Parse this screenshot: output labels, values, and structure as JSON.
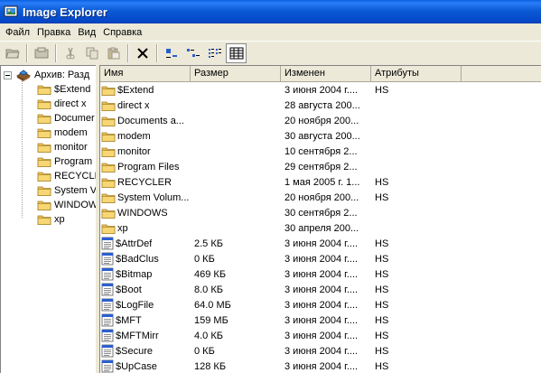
{
  "window": {
    "title": "Image Explorer"
  },
  "menu": [
    "Файл",
    "Правка",
    "Вид",
    "Справка"
  ],
  "tree": {
    "root_label": "Архив: Разд",
    "items": [
      "$Extend",
      "direct x",
      "Documer",
      "modem",
      "monitor",
      "Program",
      "RECYCLER",
      "System V",
      "WINDOW",
      "xp"
    ]
  },
  "list": {
    "columns": [
      "Имя",
      "Размер",
      "Изменен",
      "Атрибуты"
    ],
    "rows": [
      {
        "type": "folder",
        "name": "$Extend",
        "size": "",
        "modified": "3 июня 2004 г....",
        "attr": "HS"
      },
      {
        "type": "folder",
        "name": "direct x",
        "size": "",
        "modified": "28 августа 200...",
        "attr": ""
      },
      {
        "type": "folder",
        "name": "Documents a...",
        "size": "",
        "modified": "20 ноября 200...",
        "attr": ""
      },
      {
        "type": "folder",
        "name": "modem",
        "size": "",
        "modified": "30 августа 200...",
        "attr": ""
      },
      {
        "type": "folder",
        "name": "monitor",
        "size": "",
        "modified": "10 сентября 2...",
        "attr": ""
      },
      {
        "type": "folder",
        "name": "Program Files",
        "size": "",
        "modified": "29 сентября 2...",
        "attr": ""
      },
      {
        "type": "folder",
        "name": "RECYCLER",
        "size": "",
        "modified": "1 мая 2005 г. 1...",
        "attr": "HS"
      },
      {
        "type": "folder",
        "name": "System Volum...",
        "size": "",
        "modified": "20 ноября 200...",
        "attr": "HS"
      },
      {
        "type": "folder",
        "name": "WINDOWS",
        "size": "",
        "modified": "30 сентября 2...",
        "attr": ""
      },
      {
        "type": "folder",
        "name": "xp",
        "size": "",
        "modified": "30 апреля 200...",
        "attr": ""
      },
      {
        "type": "file",
        "name": "$AttrDef",
        "size": "2.5 КБ",
        "modified": "3 июня 2004 г....",
        "attr": "HS"
      },
      {
        "type": "file",
        "name": "$BadClus",
        "size": "0 КБ",
        "modified": "3 июня 2004 г....",
        "attr": "HS"
      },
      {
        "type": "file",
        "name": "$Bitmap",
        "size": "469 КБ",
        "modified": "3 июня 2004 г....",
        "attr": "HS"
      },
      {
        "type": "file",
        "name": "$Boot",
        "size": "8.0 КБ",
        "modified": "3 июня 2004 г....",
        "attr": "HS"
      },
      {
        "type": "file",
        "name": "$LogFile",
        "size": "64.0 МБ",
        "modified": "3 июня 2004 г....",
        "attr": "HS"
      },
      {
        "type": "file",
        "name": "$MFT",
        "size": "159 МБ",
        "modified": "3 июня 2004 г....",
        "attr": "HS"
      },
      {
        "type": "file",
        "name": "$MFTMirr",
        "size": "4.0 КБ",
        "modified": "3 июня 2004 г....",
        "attr": "HS"
      },
      {
        "type": "file",
        "name": "$Secure",
        "size": "0 КБ",
        "modified": "3 июня 2004 г....",
        "attr": "HS"
      },
      {
        "type": "file",
        "name": "$UpCase",
        "size": "128 КБ",
        "modified": "3 июня 2004 г....",
        "attr": "HS"
      }
    ]
  },
  "toolbar": {
    "buttons": [
      "open-icon",
      "extract-icon",
      "cut-icon",
      "copy-icon",
      "paste-icon",
      "delete-icon",
      "large-icons-view-icon",
      "small-icons-view-icon",
      "list-view-icon",
      "details-view-icon"
    ]
  },
  "colors": {
    "titlebar": "#0b5bd6",
    "face": "#ece9d8",
    "folder": "#f7d774"
  }
}
